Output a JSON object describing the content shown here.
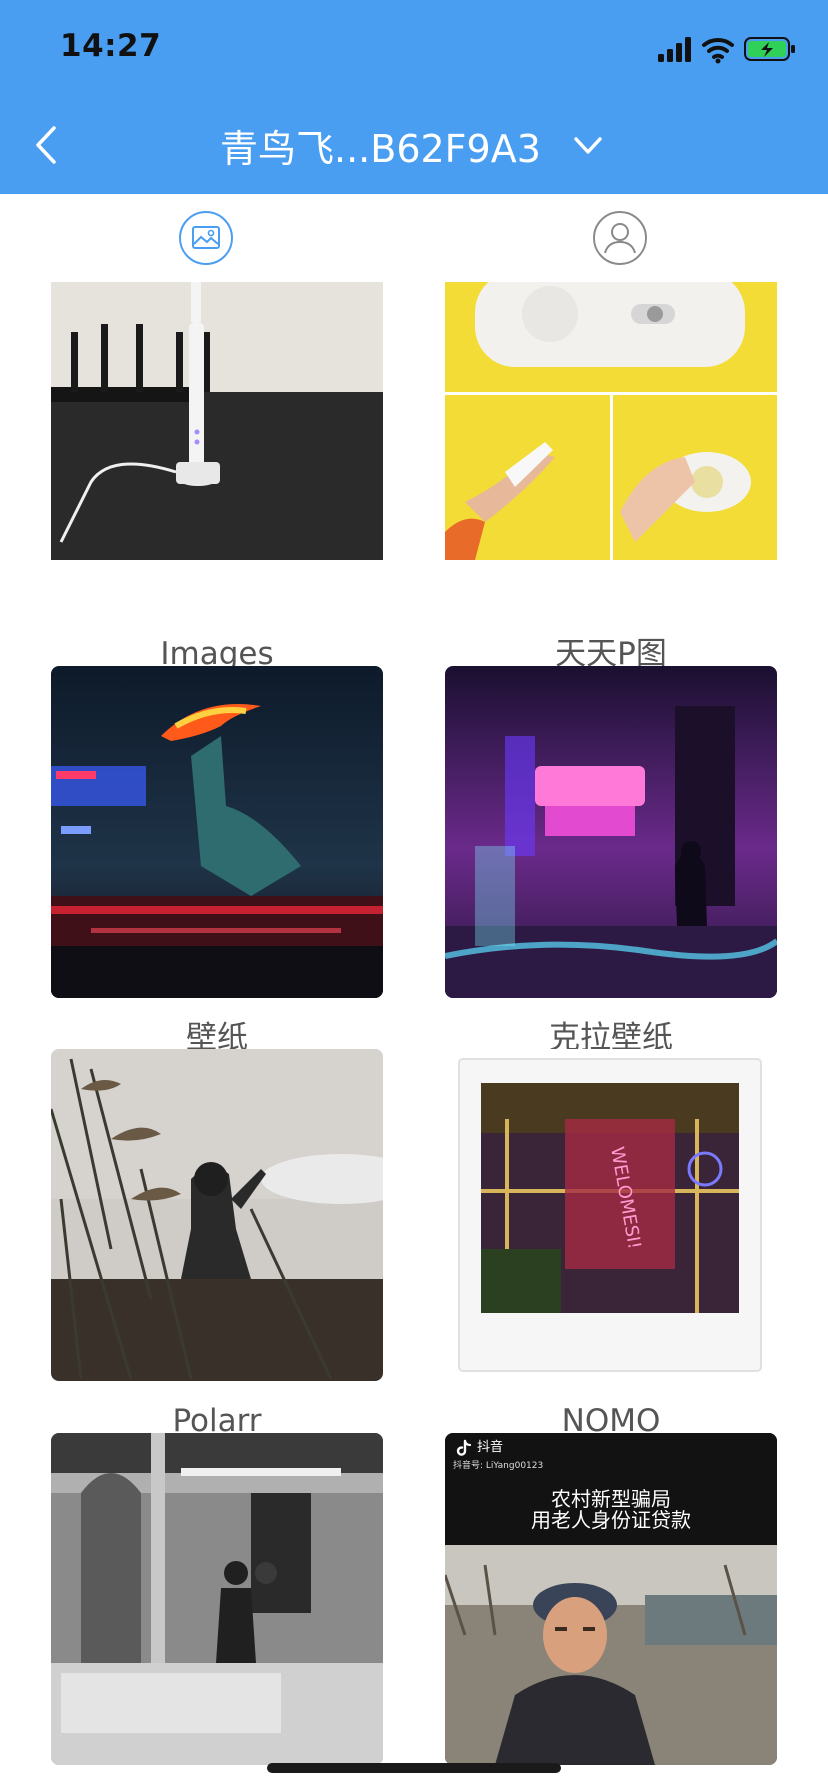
{
  "status_bar": {
    "time": "14:27"
  },
  "nav": {
    "title": "青鸟飞...B62F9A3"
  },
  "tabs": [
    {
      "name": "photos",
      "icon": "photo-icon",
      "active": true
    },
    {
      "name": "people",
      "icon": "person-icon",
      "active": false
    }
  ],
  "albums": [
    {
      "label": "Images"
    },
    {
      "label": "天天P图"
    },
    {
      "label": "壁纸"
    },
    {
      "label": "克拉壁纸"
    },
    {
      "label": "Polarr"
    },
    {
      "label": "NOMO"
    },
    {
      "label": ""
    },
    {
      "label": "",
      "caption": {
        "app": "抖音",
        "account": "抖音号: LiYang00123",
        "line1": "农村新型骗局",
        "line2": "用老人身份证贷款"
      }
    }
  ],
  "colors": {
    "header": "#4a9ef2",
    "accent": "#4a9ef2",
    "battery": "#2fd158"
  }
}
